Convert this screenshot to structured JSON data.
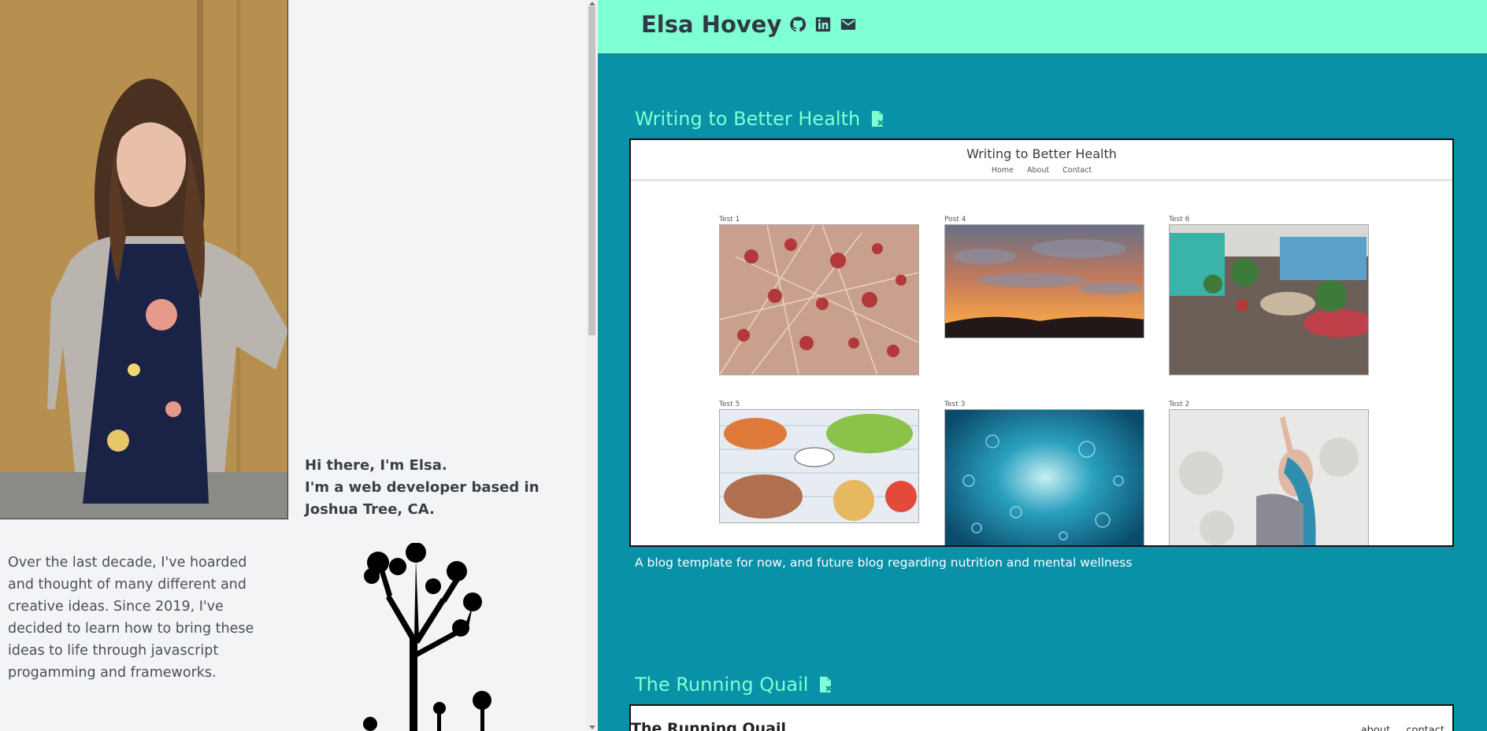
{
  "profile": {
    "intro_line1": "Hi there, I'm Elsa.",
    "intro_line2": "I'm a web developer based in Joshua Tree, CA.",
    "bio": "Over the last decade, I've hoarded and thought of many different and creative ideas. Since 2019, I've decided to learn how to bring these ideas to life through javascript progamming and frameworks."
  },
  "header": {
    "site_name": "Elsa Hovey",
    "icons": [
      "github-icon",
      "linkedin-icon",
      "email-icon"
    ]
  },
  "projects": [
    {
      "title": "Writing to Better Health",
      "preview": {
        "blog_title": "Writing to Better Health",
        "nav": [
          "Home",
          "About",
          "Contact"
        ],
        "posts": [
          {
            "label": "Test 1"
          },
          {
            "label": "Post 4"
          },
          {
            "label": "Test 6"
          },
          {
            "label": "Test 5"
          },
          {
            "label": "Test 3"
          },
          {
            "label": "Test 2"
          }
        ]
      },
      "description": "A blog template for now, and future blog regarding nutrition and mental wellness"
    },
    {
      "title": "The Running Quail",
      "preview": {
        "blog_title": "The Running Quail",
        "nav": [
          "about",
          "contact"
        ]
      }
    }
  ],
  "colors": {
    "header_bg": "#7fffd4",
    "main_bg": "#0891a7",
    "accent": "#7fffd4",
    "left_bg": "#f3f4f6"
  }
}
